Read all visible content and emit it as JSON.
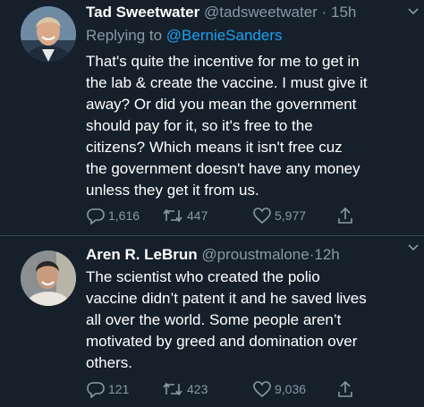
{
  "colors": {
    "background": "#15202b",
    "text": "#ffffff",
    "muted": "#8899a6",
    "link": "#1da1f2",
    "divider": "#38444d"
  },
  "tweets": [
    {
      "display_name": "Tad Sweetwater",
      "handle": "@tadsweetwater",
      "separator": "·",
      "time": "15h",
      "reply_prefix": "Replying to ",
      "reply_to": "@BernieSanders",
      "text": "That's quite the incentive for me to get in\nthe lab & create the vaccine. I must give it\naway? Or did you mean the government\nshould pay for it, so it's free to the\ncitizens?  Which means it isn't free cuz\nthe government doesn't have any money\nunless they get it from us.",
      "replies": "1,616",
      "retweets": "447",
      "likes": "5,977",
      "avatar_icon": "avatar-photo-icon"
    },
    {
      "display_name": "Aren R. LeBrun",
      "handle": "@proustmalone",
      "separator": "·",
      "time": "12h",
      "text": "The scientist who created the polio\nvaccine didn’t patent it and he saved lives\nall over the world. Some people aren’t\nmotivated by greed and domination over\nothers.",
      "replies": "121",
      "retweets": "423",
      "likes": "9,036",
      "avatar_icon": "avatar-photo-icon"
    }
  ],
  "icons": {
    "reply": "reply-icon",
    "retweet": "retweet-icon",
    "like": "heart-icon",
    "share": "share-icon",
    "more": "chevron-down-icon"
  }
}
